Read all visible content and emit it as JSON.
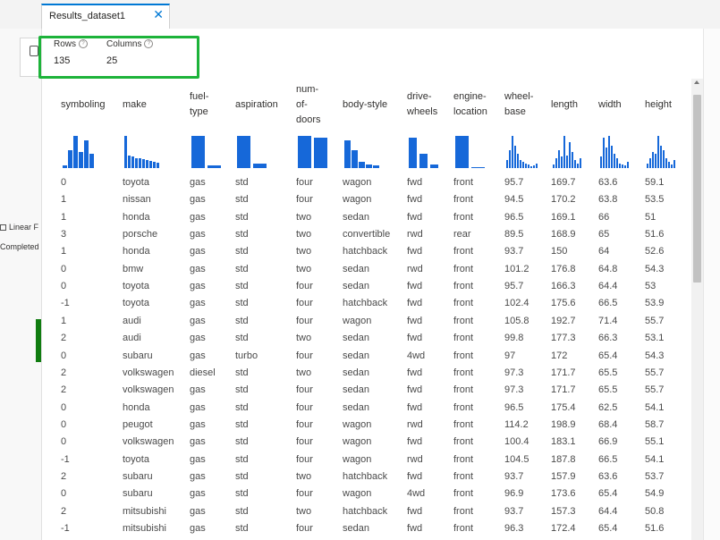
{
  "tab": {
    "title": "Results_dataset1",
    "close": "✕"
  },
  "background": {
    "linear_label": "Linear F",
    "completed_label": "Completed"
  },
  "stats": {
    "rows": {
      "label": "Rows",
      "value": "135"
    },
    "columns": {
      "label": "Columns",
      "value": "25"
    },
    "info_glyph": "?"
  },
  "table": {
    "columns": [
      {
        "label": [
          "symboling"
        ]
      },
      {
        "label": [
          "make"
        ]
      },
      {
        "label": [
          "fuel-",
          "type"
        ]
      },
      {
        "label": [
          "aspiration"
        ]
      },
      {
        "label": [
          "num-",
          "of-",
          "doors"
        ]
      },
      {
        "label": [
          "body-style"
        ]
      },
      {
        "label": [
          "drive-",
          "wheels"
        ]
      },
      {
        "label": [
          "engine-",
          "location"
        ]
      },
      {
        "label": [
          "wheel-",
          "base"
        ]
      },
      {
        "label": [
          "length"
        ]
      },
      {
        "label": [
          "width"
        ]
      },
      {
        "label": [
          "height"
        ]
      }
    ],
    "histograms": [
      [
        0.08,
        0.55,
        1.0,
        0.5,
        0.85,
        0.45
      ],
      [
        1.0,
        0.4,
        0.35,
        0.3,
        0.3,
        0.28,
        0.25,
        0.22,
        0.2,
        0.18
      ],
      [
        1.0,
        0.08
      ],
      [
        1.0,
        0.15
      ],
      [
        1.0,
        0.95
      ],
      [
        0.85,
        0.55,
        0.2,
        0.12,
        0.08
      ],
      [
        0.95,
        0.45,
        0.1
      ],
      [
        1.0,
        0.04
      ],
      [
        0.25,
        0.55,
        1.0,
        0.7,
        0.45,
        0.25,
        0.2,
        0.15,
        0.1,
        0.05,
        0.08,
        0.15
      ],
      [
        0.1,
        0.3,
        0.55,
        0.35,
        1.0,
        0.4,
        0.8,
        0.5,
        0.25,
        0.15,
        0.3
      ],
      [
        0.35,
        0.95,
        0.65,
        1.0,
        0.7,
        0.45,
        0.3,
        0.15,
        0.1,
        0.08,
        0.2
      ],
      [
        0.15,
        0.3,
        0.5,
        0.45,
        1.0,
        0.7,
        0.55,
        0.3,
        0.2,
        0.1,
        0.25
      ]
    ],
    "rows": [
      [
        "0",
        "toyota",
        "gas",
        "std",
        "four",
        "wagon",
        "fwd",
        "front",
        "95.7",
        "169.7",
        "63.6",
        "59.1"
      ],
      [
        "1",
        "nissan",
        "gas",
        "std",
        "four",
        "wagon",
        "fwd",
        "front",
        "94.5",
        "170.2",
        "63.8",
        "53.5"
      ],
      [
        "1",
        "honda",
        "gas",
        "std",
        "two",
        "sedan",
        "fwd",
        "front",
        "96.5",
        "169.1",
        "66",
        "51"
      ],
      [
        "3",
        "porsche",
        "gas",
        "std",
        "two",
        "convertible",
        "rwd",
        "rear",
        "89.5",
        "168.9",
        "65",
        "51.6"
      ],
      [
        "1",
        "honda",
        "gas",
        "std",
        "two",
        "hatchback",
        "fwd",
        "front",
        "93.7",
        "150",
        "64",
        "52.6"
      ],
      [
        "0",
        "bmw",
        "gas",
        "std",
        "two",
        "sedan",
        "rwd",
        "front",
        "101.2",
        "176.8",
        "64.8",
        "54.3"
      ],
      [
        "0",
        "toyota",
        "gas",
        "std",
        "four",
        "sedan",
        "fwd",
        "front",
        "95.7",
        "166.3",
        "64.4",
        "53"
      ],
      [
        "-1",
        "toyota",
        "gas",
        "std",
        "four",
        "hatchback",
        "fwd",
        "front",
        "102.4",
        "175.6",
        "66.5",
        "53.9"
      ],
      [
        "1",
        "audi",
        "gas",
        "std",
        "four",
        "wagon",
        "fwd",
        "front",
        "105.8",
        "192.7",
        "71.4",
        "55.7"
      ],
      [
        "2",
        "audi",
        "gas",
        "std",
        "two",
        "sedan",
        "fwd",
        "front",
        "99.8",
        "177.3",
        "66.3",
        "53.1"
      ],
      [
        "0",
        "subaru",
        "gas",
        "turbo",
        "four",
        "sedan",
        "4wd",
        "front",
        "97",
        "172",
        "65.4",
        "54.3"
      ],
      [
        "2",
        "volkswagen",
        "diesel",
        "std",
        "two",
        "sedan",
        "fwd",
        "front",
        "97.3",
        "171.7",
        "65.5",
        "55.7"
      ],
      [
        "2",
        "volkswagen",
        "gas",
        "std",
        "four",
        "sedan",
        "fwd",
        "front",
        "97.3",
        "171.7",
        "65.5",
        "55.7"
      ],
      [
        "0",
        "honda",
        "gas",
        "std",
        "four",
        "sedan",
        "fwd",
        "front",
        "96.5",
        "175.4",
        "62.5",
        "54.1"
      ],
      [
        "0",
        "peugot",
        "gas",
        "std",
        "four",
        "wagon",
        "rwd",
        "front",
        "114.2",
        "198.9",
        "68.4",
        "58.7"
      ],
      [
        "0",
        "volkswagen",
        "gas",
        "std",
        "four",
        "wagon",
        "fwd",
        "front",
        "100.4",
        "183.1",
        "66.9",
        "55.1"
      ],
      [
        "-1",
        "toyota",
        "gas",
        "std",
        "four",
        "wagon",
        "rwd",
        "front",
        "104.5",
        "187.8",
        "66.5",
        "54.1"
      ],
      [
        "2",
        "subaru",
        "gas",
        "std",
        "two",
        "hatchback",
        "fwd",
        "front",
        "93.7",
        "157.9",
        "63.6",
        "53.7"
      ],
      [
        "0",
        "subaru",
        "gas",
        "std",
        "four",
        "wagon",
        "4wd",
        "front",
        "96.9",
        "173.6",
        "65.4",
        "54.9"
      ],
      [
        "2",
        "mitsubishi",
        "gas",
        "std",
        "two",
        "hatchback",
        "fwd",
        "front",
        "93.7",
        "157.3",
        "64.4",
        "50.8"
      ],
      [
        "-1",
        "mitsubishi",
        "gas",
        "std",
        "four",
        "sedan",
        "fwd",
        "front",
        "96.3",
        "172.4",
        "65.4",
        "51.6"
      ]
    ]
  },
  "colors": {
    "accent": "#0078d4",
    "bar": "#1668d9",
    "highlight": "#1db33a",
    "status_green": "#107c10"
  }
}
